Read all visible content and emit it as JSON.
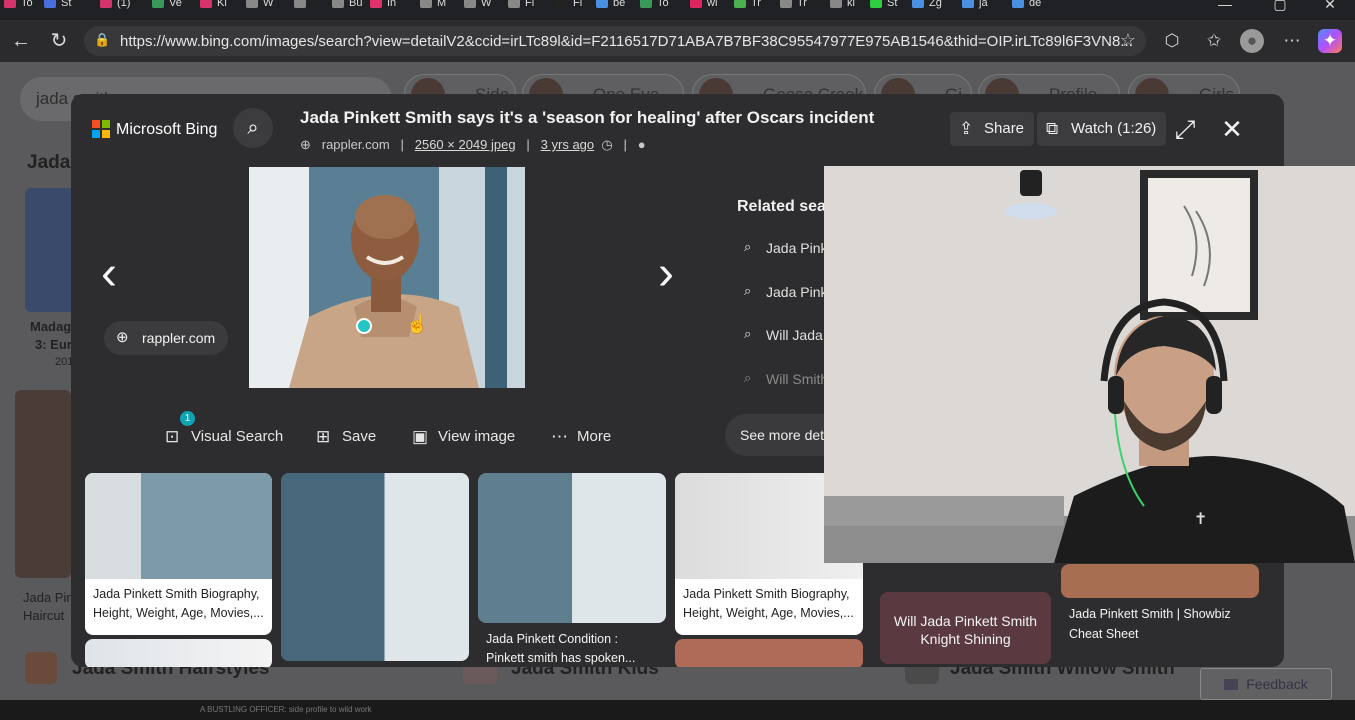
{
  "browser": {
    "tabs": [
      {
        "label": "To",
        "color": "#d6336c"
      },
      {
        "label": "St",
        "color": "#4a6ee0"
      },
      {
        "label": "(1)",
        "color": "#d6336c"
      },
      {
        "label": "Ve",
        "color": "#3a9a5a"
      },
      {
        "label": "Ki",
        "color": "#d6336c"
      },
      {
        "label": "W",
        "color": "#888888"
      },
      {
        "label": "",
        "color": "#888888"
      },
      {
        "label": "Bu",
        "color": "#888888"
      },
      {
        "label": "In",
        "color": "#e1306c"
      },
      {
        "label": "M",
        "color": "#888888"
      },
      {
        "label": "W",
        "color": "#888888"
      },
      {
        "label": "Fi",
        "color": "#888888"
      },
      {
        "label": "Fi",
        "color": "#222222"
      },
      {
        "label": "be",
        "color": "#4a90e2"
      },
      {
        "label": "To",
        "color": "#3a9a5a"
      },
      {
        "label": "wi",
        "color": "#e0245e"
      },
      {
        "label": "Tr",
        "color": "#4caf50"
      },
      {
        "label": "Tr",
        "color": "#888888"
      },
      {
        "label": "kl",
        "color": "#888888"
      },
      {
        "label": "St",
        "color": "#2ecc40"
      },
      {
        "label": "Zg",
        "color": "#4a90e2"
      },
      {
        "label": "ja",
        "color": "#4a90e2"
      },
      {
        "label": "de",
        "color": "#4a90e2"
      }
    ],
    "url": "https://www.bing.com/images/search?view=detailV2&ccid=irLTc89l&id=F2116517D71ABA7B7BF38C95547977E975AB1546&thid=OIP.irLTc89l6F3VN8..."
  },
  "bg_page": {
    "search_text": "jada smith",
    "chips": [
      "Side",
      "One Eye",
      "Goose Creek",
      "Gi",
      "Profile",
      "Girls"
    ],
    "heading_left": "Jada",
    "left_card_title": "Madag",
    "left_card_title2": "3: Euro",
    "left_card_year": "201",
    "left_caption": "Jada Pin",
    "left_caption2": "Haircut",
    "related_bottom_1": "Jada Smith Hairstyles",
    "related_bottom_2": "Jada Smith Kids",
    "related_bottom_3": "Jada Smith Willow Smith",
    "card_will_jada": "Will Jada Pinkett Smith Knight Shining",
    "card_showbiz": "Jada Pinkett Smith | Showbiz Cheat Sheet",
    "feedback": "Feedback",
    "bottom_text": "A BUSTLING OFFICER: side profile to wild work"
  },
  "modal": {
    "logo": "Microsoft Bing",
    "title": "Jada Pinkett Smith says it's a 'season for healing' after Oscars incident",
    "source": "rappler.com",
    "size": "2560 × 2049 jpeg",
    "age": "3 yrs ago",
    "share": "Share",
    "watch": "Watch (1:26)",
    "source_pill": "rappler.com",
    "actions": {
      "visual_search": "Visual Search",
      "visual_badge": "1",
      "save": "Save",
      "view_image": "View image",
      "more": "More"
    },
    "related_heading": "Related sea",
    "related": [
      "Jada Pink",
      "Jada Pink",
      "Will Jada",
      "Will Smith"
    ],
    "see_more": "See more deta",
    "grid": [
      {
        "caption1": "Jada Pinkett Smith Biography,",
        "caption2": "Height, Weight, Age, Movies,..."
      },
      {
        "caption1": "",
        "caption2": ""
      },
      {
        "caption1": "Jada Pinkett Condition :",
        "caption2": "Pinkett smith has spoken..."
      },
      {
        "caption1": "Jada Pinkett Smith Biography,",
        "caption2": "Height, Weight, Age, Movies,..."
      }
    ]
  },
  "colors": {
    "accent": "#10a3b4",
    "modal_bg": "#2d2d2f",
    "cursor": "#23c4c4"
  }
}
